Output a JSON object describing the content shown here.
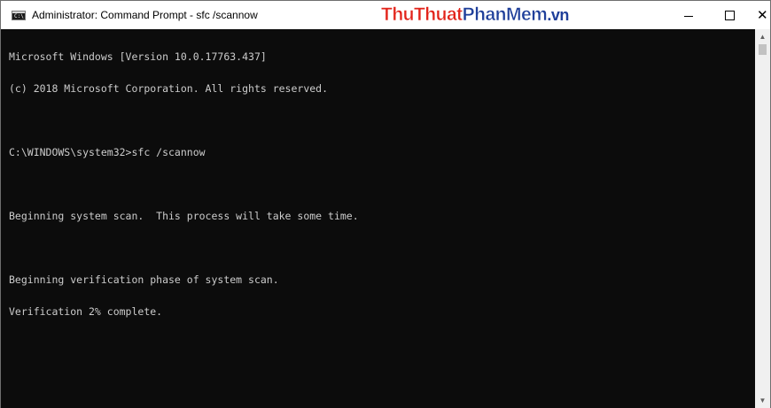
{
  "window": {
    "title": "Administrator: Command Prompt - sfc  /scannow"
  },
  "watermark": {
    "part1": "ThuThuat",
    "part2": "PhanMem",
    "part3": ".vn"
  },
  "controls": {
    "minimize_icon": "minimize-icon",
    "maximize_icon": "maximize-icon",
    "close_icon": "close-icon",
    "close_glyph": "✕"
  },
  "console": {
    "lines": [
      "Microsoft Windows [Version 10.0.17763.437]",
      "(c) 2018 Microsoft Corporation. All rights reserved.",
      "",
      "C:\\WINDOWS\\system32>sfc /scannow",
      "",
      "Beginning system scan.  This process will take some time.",
      "",
      "Beginning verification phase of system scan.",
      "Verification 2% complete."
    ]
  },
  "scrollbar": {
    "up_arrow": "▲",
    "down_arrow": "▼"
  },
  "colors": {
    "console_bg": "#0c0c0c",
    "console_fg": "#cccccc",
    "titlebar_bg": "#ffffff"
  }
}
